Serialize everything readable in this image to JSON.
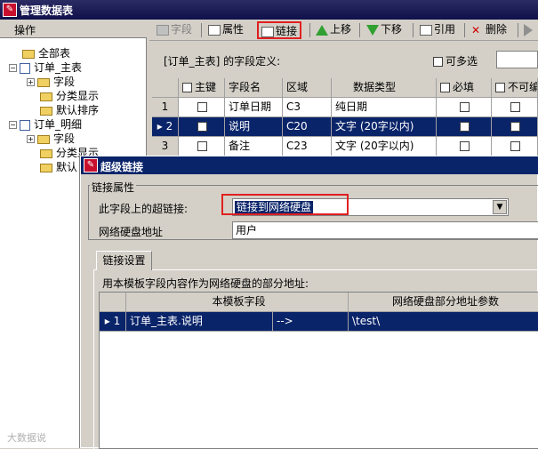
{
  "window": {
    "title": "管理数据表"
  },
  "left_panel": {
    "header": "操作",
    "tree": [
      {
        "label": "全部表"
      },
      {
        "label": "订单_主表"
      },
      {
        "label": "字段"
      },
      {
        "label": "分类显示"
      },
      {
        "label": "默认排序"
      },
      {
        "label": "订单_明细"
      },
      {
        "label": "字段"
      },
      {
        "label": "分类显示"
      },
      {
        "label": "默认"
      }
    ]
  },
  "toolbar": {
    "items": [
      {
        "label": "字段",
        "icon": "field-icon"
      },
      {
        "label": "属性",
        "icon": "properties-icon"
      },
      {
        "label": "链接",
        "icon": "link-icon"
      },
      {
        "label": "上移",
        "icon": "up-arrow-icon"
      },
      {
        "label": "下移",
        "icon": "down-arrow-icon"
      },
      {
        "label": "引用",
        "icon": "reference-icon"
      },
      {
        "label": "删除",
        "icon": "delete-x-icon"
      }
    ]
  },
  "fields_section": {
    "label": "[订单_主表] 的字段定义:",
    "multi_select_label": "可多选",
    "columns": [
      "主键",
      "字段名",
      "区域",
      "数据类型",
      "必填",
      "不可编辑"
    ],
    "rows": [
      {
        "num": "1",
        "name": "订单日期",
        "area": "C3",
        "type": "纯日期"
      },
      {
        "num": "2",
        "name": "说明",
        "area": "C20",
        "type": "文字 (20字以内)"
      },
      {
        "num": "3",
        "name": "备注",
        "area": "C23",
        "type": "文字 (20字以内)"
      }
    ]
  },
  "dialog": {
    "title": "超级链接",
    "group_label": "链接属性",
    "hyperlink_label": "此字段上的超链接:",
    "hyperlink_value": "链接到网络硬盘",
    "address_label": "网络硬盘地址",
    "address_value": "用户",
    "tab_label": "链接设置",
    "desc": "用本模板字段内容作为网络硬盘的部分地址:",
    "grid_columns": [
      "本模板字段",
      "网络硬盘部分地址参数"
    ],
    "grid_rows": [
      {
        "num": "1",
        "field": "订单_主表.说明",
        "arrow": "-->",
        "param": "\\test\\"
      }
    ]
  },
  "watermark": "大数据说",
  "colors": {
    "highlight": "#e02020",
    "selection": "#0a246a",
    "title_bar": "#1a1a58"
  }
}
